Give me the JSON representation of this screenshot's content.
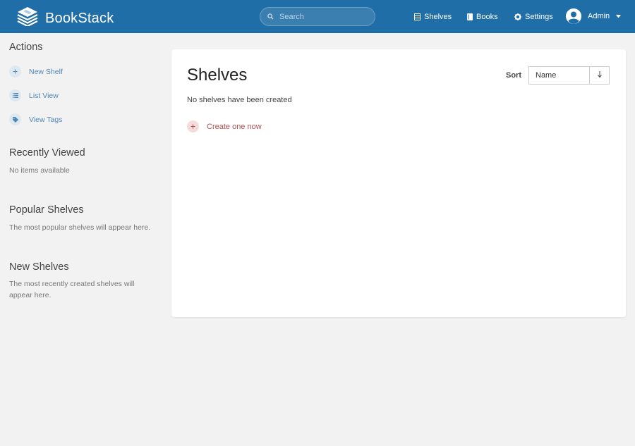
{
  "header": {
    "app_name": "BookStack",
    "search_placeholder": "Search",
    "nav": [
      {
        "label": "Shelves",
        "icon": "shelves-icon"
      },
      {
        "label": "Books",
        "icon": "book-icon"
      },
      {
        "label": "Settings",
        "icon": "gear-icon"
      }
    ],
    "user_name": "Admin"
  },
  "sidebar": {
    "actions_title": "Actions",
    "actions": [
      {
        "label": "New Shelf",
        "icon": "plus-icon"
      },
      {
        "label": "List View",
        "icon": "list-icon"
      },
      {
        "label": "View Tags",
        "icon": "tag-icon"
      }
    ],
    "recently_viewed_title": "Recently Viewed",
    "recently_viewed_text": "No items available",
    "popular_title": "Popular Shelves",
    "popular_text": "The most popular shelves will appear here.",
    "new_title": "New Shelves",
    "new_text_line1": "The most recently created shelves will",
    "new_text_line2": "appear here."
  },
  "main": {
    "title": "Shelves",
    "sort_label": "Sort",
    "sort_value": "Name",
    "sort_direction_icon": "arrow-down-icon",
    "empty_text": "No shelves have been created",
    "create_label": "Create one now"
  },
  "colors": {
    "header_bg": "#206ea7",
    "link_blue": "#4f86b8",
    "create_red": "#b54d4d",
    "page_bg": "#f2f2f2"
  }
}
